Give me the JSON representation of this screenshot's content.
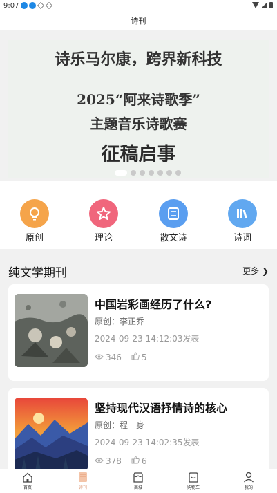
{
  "status_bar": {
    "time": "9:07"
  },
  "header": {
    "title": "诗刊"
  },
  "banner": {
    "line1": "诗乐马尔康，跨界新科技",
    "line2": "2025“阿来诗歌季”",
    "line3": "主题音乐诗歌赛",
    "line4": "征稿启事",
    "page_count": 7,
    "active_page": 1
  },
  "categories": [
    {
      "label": "原创",
      "icon": "lightbulb-icon",
      "color": "#f5a44a"
    },
    {
      "label": "理论",
      "icon": "star-icon",
      "color": "#f0667c"
    },
    {
      "label": "散文诗",
      "icon": "document-icon",
      "color": "#5a9ef0"
    },
    {
      "label": "诗词",
      "icon": "books-icon",
      "color": "#61a8f0"
    }
  ],
  "section": {
    "title": "纯文学期刊",
    "more": "更多"
  },
  "articles": [
    {
      "title": "中国岩彩画经历了什么?",
      "author": "原创：李正乔",
      "date": "2024-09-23 14:12:03发表",
      "views": "346",
      "likes": "5"
    },
    {
      "title": "坚持现代汉语抒情诗的核心",
      "author": "原创：程一身",
      "date": "2024-09-23 14:02:35发表",
      "views": "378",
      "likes": "6"
    }
  ],
  "tabbar": [
    {
      "label": "首页",
      "icon": "home-icon"
    },
    {
      "label": "诗刊",
      "icon": "journal-icon",
      "active": true
    },
    {
      "label": "商城",
      "icon": "shop-icon"
    },
    {
      "label": "购物车",
      "icon": "cart-icon"
    },
    {
      "label": "我的",
      "icon": "profile-icon"
    }
  ]
}
